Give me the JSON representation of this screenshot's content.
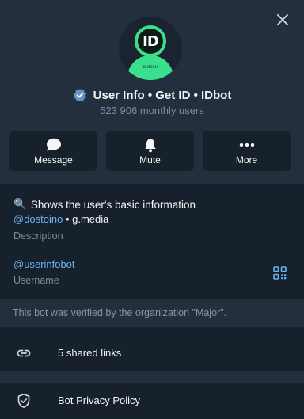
{
  "header": {
    "name": "User Info • Get ID • IDbot",
    "subtitle": "523 906 monthly users",
    "avatar_text": "ID",
    "avatar_tag": "ID.MEDIA"
  },
  "actions": [
    {
      "label": "Message",
      "icon": "message-icon"
    },
    {
      "label": "Mute",
      "icon": "bell-icon"
    },
    {
      "label": "More",
      "icon": "more-icon"
    }
  ],
  "info": {
    "bio_text": "Shows the user's basic information",
    "bio_emoji": "🔍",
    "mention": "@dostoino",
    "separator": " • ",
    "media": "g.media",
    "description_label": "Description",
    "username": "@userinfobot",
    "username_label": "Username"
  },
  "verified_text": "This bot was verified by the organization \"Major\".",
  "rows": {
    "links": "5 shared links",
    "privacy": "Bot Privacy Policy"
  },
  "colors": {
    "background": "#17212b",
    "card": "#242f3d",
    "link": "#6ab3f3",
    "muted": "#7f8b97",
    "verified_badge": "#5f93c9",
    "avatar_green": "#3be08f"
  }
}
